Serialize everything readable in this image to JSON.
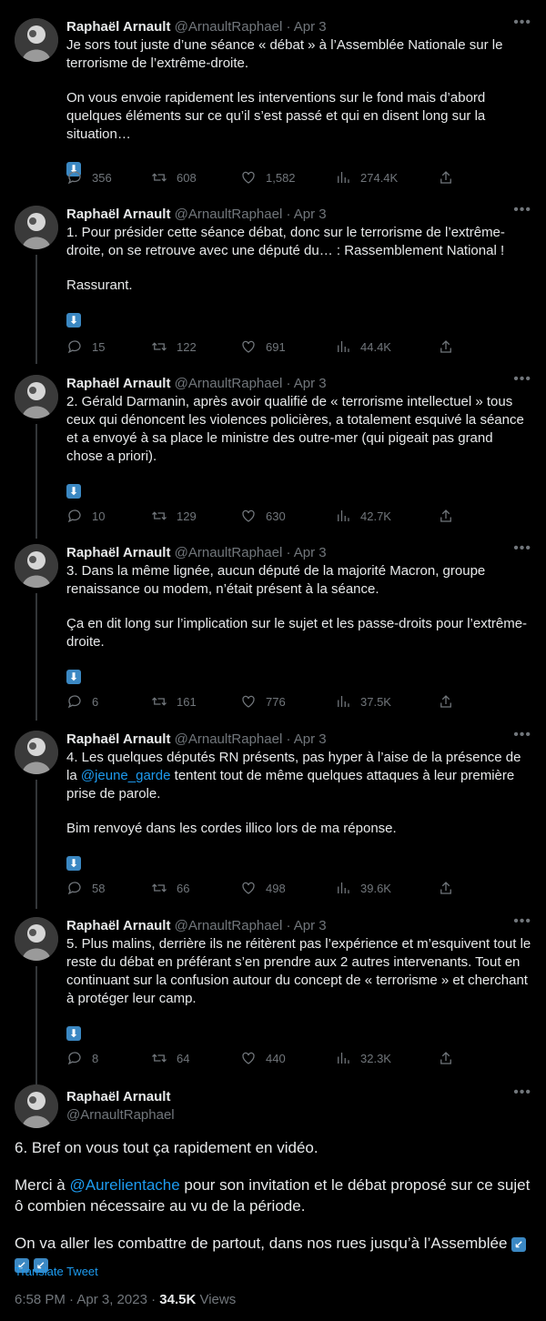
{
  "author": {
    "name": "Raphaël Arnault",
    "handle": "@ArnaultRaphael",
    "date": "Apr 3"
  },
  "more_icon": "more-horizontal-icon",
  "tweets": [
    {
      "paragraphs": [
        "Je sors tout juste d’une séance « débat » à l’Assemblée Nationale sur le terrorisme de l’extrême-droite.",
        "On vous envoie rapidement les interventions sur le fond mais d’abord quelques éléments sur ce qu’il s’est passé et qui en disent long sur la situation…"
      ],
      "arrow": "⬇",
      "replies": "356",
      "retweets": "608",
      "likes": "1,582",
      "views": "274.4K"
    },
    {
      "paragraphs": [
        "1. Pour présider cette séance débat, donc sur le terrorisme de l’extrême-droite, on se retrouve avec une député du… : Rassemblement National !",
        "Rassurant."
      ],
      "arrow": "⬇",
      "replies": "15",
      "retweets": "122",
      "likes": "691",
      "views": "44.4K"
    },
    {
      "paragraphs": [
        "2. Gérald Darmanin, après avoir qualifié de « terrorisme intellectuel » tous ceux qui dénoncent les violences policières, a totalement esquivé la séance et a envoyé à sa place le ministre des outre-mer (qui pigeait pas grand chose a priori)."
      ],
      "arrow": "⬇",
      "replies": "10",
      "retweets": "129",
      "likes": "630",
      "views": "42.7K"
    },
    {
      "paragraphs": [
        "3. Dans la même lignée, aucun député de la majorité Macron, groupe renaissance ou modem, n’était présent à la séance.",
        "Ça en dit long sur l’implication sur le sujet et les passe-droits pour l’extrême-droite."
      ],
      "arrow": "⬇",
      "replies": "6",
      "retweets": "161",
      "likes": "776",
      "views": "37.5K"
    },
    {
      "paragraphs_html_parts": {
        "p1_before": "4. Les quelques députés RN présents, pas hyper à l’aise de la présence de la ",
        "p1_mention": "@jeune_garde",
        "p1_after": " tentent tout de même quelques attaques à leur première prise de parole.",
        "p2": "Bim renvoyé dans les cordes illico lors de ma réponse."
      },
      "arrow": "⬇",
      "replies": "58",
      "retweets": "66",
      "likes": "498",
      "views": "39.6K"
    },
    {
      "paragraphs": [
        "5. Plus malins, derrière ils ne réitèrent pas l’expérience et m’esquivent tout le reste du débat en préférant s’en prendre aux 2 autres intervenants. Tout en continuant sur la confusion autour du concept de « terrorisme » et cherchant à protéger leur camp."
      ],
      "arrow": "⬇",
      "replies": "8",
      "retweets": "64",
      "likes": "440",
      "views": "32.3K"
    }
  ],
  "main_tweet": {
    "p1": "6. Bref on vous tout ça rapidement en vidéo.",
    "p2_before": "Merci à ",
    "p2_mention": "@Aurelientache",
    "p2_after": " pour son invitation et le débat proposé sur ce sujet ô combien nécessaire au vu de la période.",
    "p3": "On va aller les combattre de partout, dans nos rues jusqu’à l’Assemblée",
    "arrows": "↙",
    "translate": "Translate Tweet",
    "time": "6:58 PM · Apr 3, 2023 · ",
    "views_count": "34.5K",
    "views_label": " Views"
  }
}
